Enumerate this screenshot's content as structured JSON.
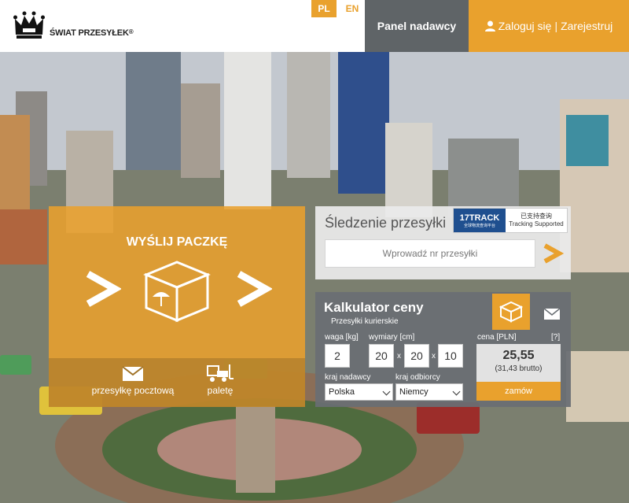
{
  "header": {
    "brand": "ŚWIAT PRZESYŁEK",
    "brand_mark": "®",
    "lang_pl": "PL",
    "lang_en": "EN",
    "panel_label": "Panel nadawcy",
    "login_label": "Zaloguj się",
    "separator": "|",
    "register_label": "Zarejestruj"
  },
  "send": {
    "title": "WYŚLIJ PACZKĘ",
    "option_letter": "przesyłkę pocztową",
    "option_pallet": "paletę"
  },
  "tracking": {
    "title": "Śledzenie przesyłki",
    "input_placeholder": "Wprowadź nr przesyłki",
    "badge_brand": "17TRACK",
    "badge_sub": "全球物流查询平台",
    "badge_line1": "已支持查询",
    "badge_line2": "Tracking Supported"
  },
  "calculator": {
    "title": "Kalkulator ceny",
    "subtitle": "Przesyłki kurierskie",
    "weight_label": "waga [kg]",
    "dims_label": "wymiary [cm]",
    "price_label": "cena [PLN]",
    "help_label": "[?]",
    "weight": "2",
    "dim1": "20",
    "dim2": "20",
    "dim3": "10",
    "times": "x",
    "sender_country_label": "kraj nadawcy",
    "recipient_country_label": "kraj odbiorcy",
    "sender_country": "Polska",
    "recipient_country": "Niemcy",
    "price": "25,55",
    "price_brutto": "(31,43 brutto)",
    "order_label": "zamów"
  },
  "colors": {
    "accent": "#e9a12d",
    "panel_gray": "#5f6467"
  }
}
